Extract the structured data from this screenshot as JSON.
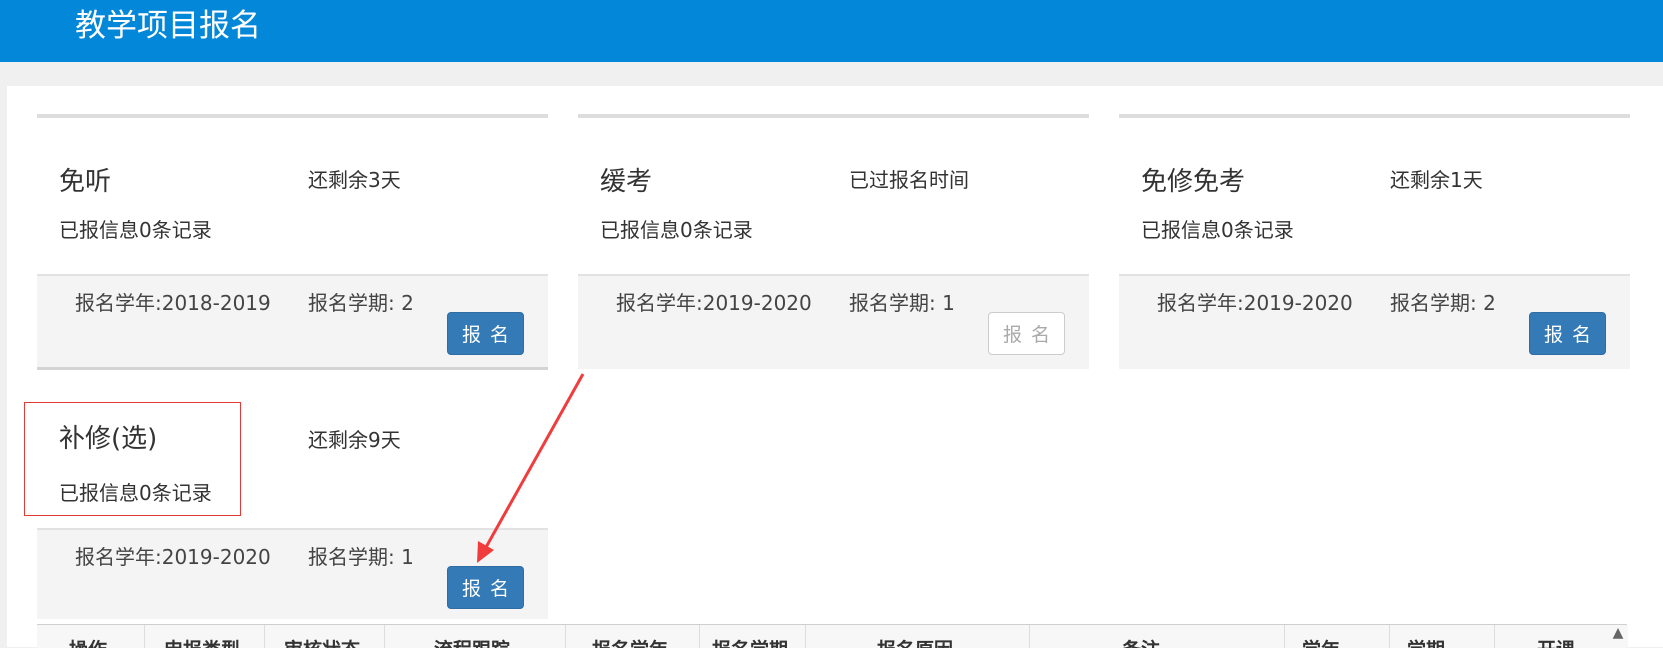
{
  "header": {
    "title": "教学项目报名"
  },
  "cards": [
    {
      "name": "免听",
      "remain": "还剩余3天",
      "records": "已报信息0条记录",
      "year": "报名学年:2018-2019",
      "term": "报名学期: 2",
      "button": "报名",
      "enabled": true
    },
    {
      "name": "缓考",
      "remain": "已过报名时间",
      "records": "已报信息0条记录",
      "year": "报名学年:2019-2020",
      "term": "报名学期: 1",
      "button": "报名",
      "enabled": false
    },
    {
      "name": "免修免考",
      "remain": "还剩余1天",
      "records": "已报信息0条记录",
      "year": "报名学年:2019-2020",
      "term": "报名学期: 2",
      "button": "报名",
      "enabled": true
    },
    {
      "name": "补修(选)",
      "remain": "还剩余9天",
      "records": "已报信息0条记录",
      "year": "报名学年:2019-2020",
      "term": "报名学期: 1",
      "button": "报名",
      "enabled": true
    }
  ],
  "table": {
    "columns": [
      "操作",
      "申报类型",
      "审核状态",
      "流程跟踪",
      "报名学年",
      "报名学期",
      "报名原因",
      "备注",
      "学年",
      "学期",
      "开课"
    ]
  },
  "colors": {
    "header": "#0387d8",
    "primary_button": "#337ab7",
    "highlight": "#e53935"
  }
}
